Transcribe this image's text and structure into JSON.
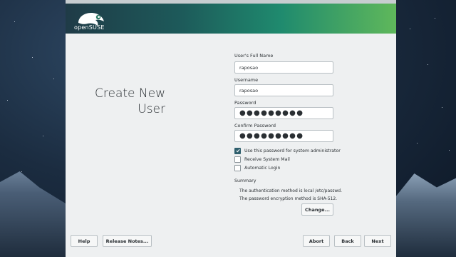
{
  "brand": {
    "logo_text": "openSUSE"
  },
  "page": {
    "title_line1": "Create New",
    "title_line2": "User"
  },
  "form": {
    "full_name_label": "User's Full Name",
    "full_name_value": "raposao",
    "username_label": "Username",
    "username_value": "raposao",
    "password_label": "Password",
    "password_mask": "●●●●●●●●●",
    "confirm_label": "Confirm Password",
    "confirm_mask": "●●●●●●●●●"
  },
  "options": [
    {
      "label": "Use this password for system administrator",
      "checked": true
    },
    {
      "label": "Receive System Mail",
      "checked": false
    },
    {
      "label": "Automatic Login",
      "checked": false
    }
  ],
  "summary": {
    "title": "Summary",
    "line1": "The authentication method is local /etc/passwd.",
    "line2": "The password encryption method is SHA-512.",
    "change_button": "Change..."
  },
  "footer": {
    "help": "Help",
    "release_notes": "Release Notes...",
    "abort": "Abort",
    "back": "Back",
    "next": "Next"
  },
  "colors": {
    "checkbox_checked": "#2f5f6d",
    "header_start": "#1f3b47",
    "header_end": "#5fb85b"
  }
}
